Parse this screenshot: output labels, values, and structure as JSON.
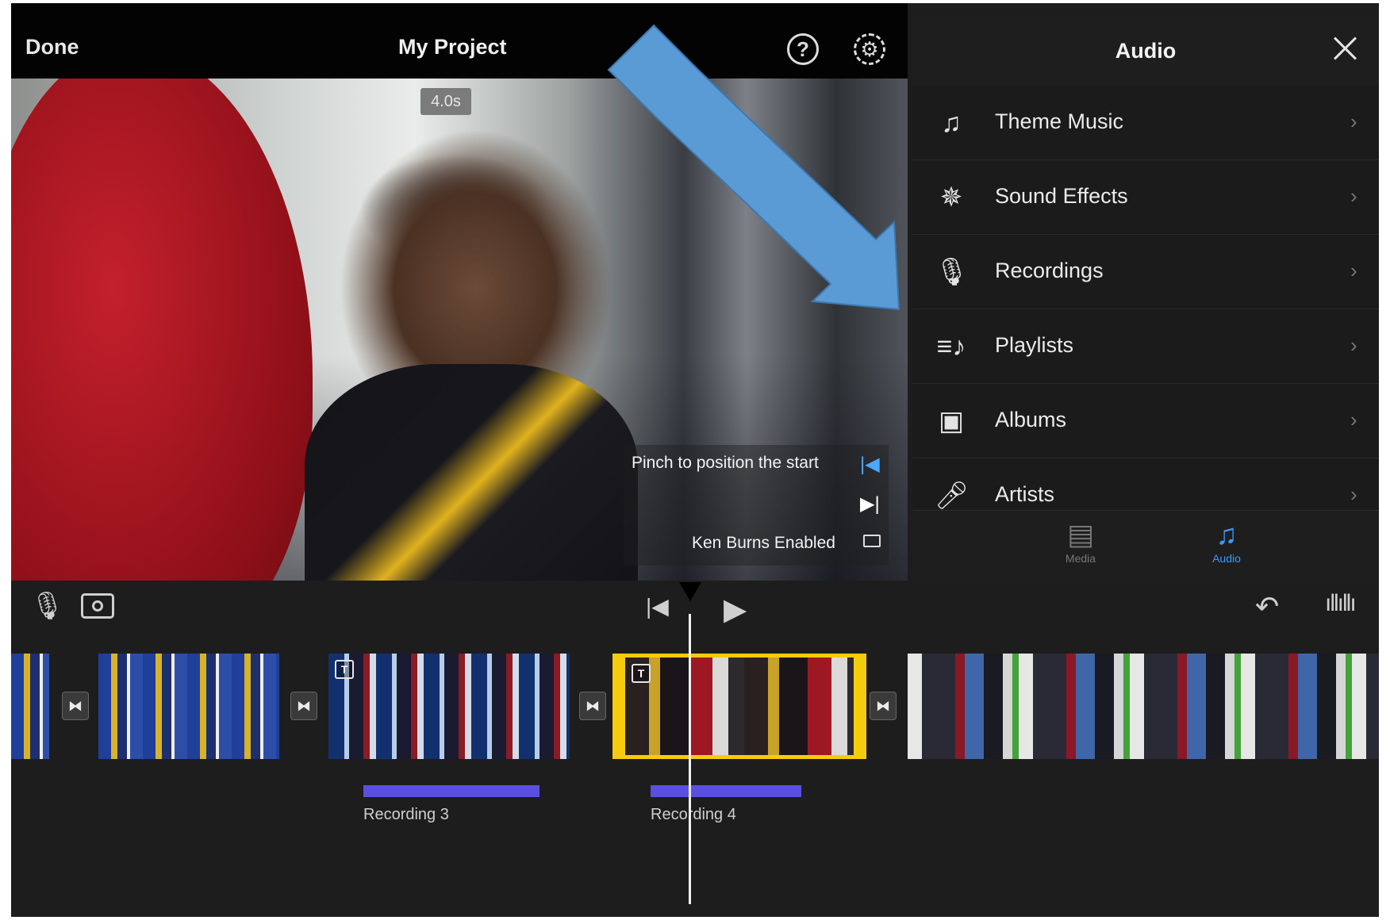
{
  "header": {
    "done_label": "Done",
    "project_title": "My Project",
    "help_icon": "question-mark-icon",
    "settings_icon": "gear-icon"
  },
  "viewer": {
    "clip_duration": "4.0s",
    "pinch_hint": "Pinch to position the start",
    "ken_burns_status": "Ken Burns Enabled"
  },
  "audio_panel": {
    "title": "Audio",
    "items": [
      {
        "label": "Theme Music",
        "icon": "music-note-icon"
      },
      {
        "label": "Sound Effects",
        "icon": "starburst-icon"
      },
      {
        "label": "Recordings",
        "icon": "microphone-icon"
      },
      {
        "label": "Playlists",
        "icon": "playlist-icon"
      },
      {
        "label": "Albums",
        "icon": "album-icon"
      },
      {
        "label": "Artists",
        "icon": "handheld-mic-icon"
      }
    ],
    "tabs": [
      {
        "label": "Media",
        "icon": "filmstrip-icon",
        "active": false
      },
      {
        "label": "Audio",
        "icon": "music-note-icon",
        "active": true
      }
    ],
    "active_tab_color": "#3a9bff"
  },
  "timeline": {
    "recordings": [
      {
        "label": "Recording 3"
      },
      {
        "label": "Recording 4"
      }
    ],
    "selected_clip_color": "#f5cc0c",
    "recording_color": "#5b4fe1"
  },
  "annotation": {
    "arrow_color": "#5b9bd5"
  }
}
